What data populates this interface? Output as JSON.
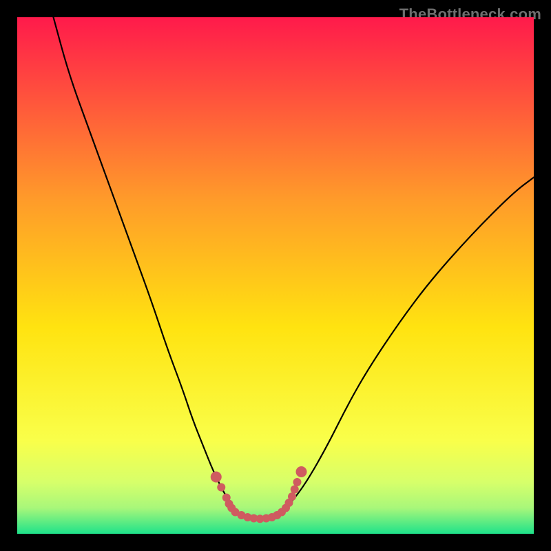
{
  "watermark": "TheBottleneck.com",
  "colors": {
    "background": "#000000",
    "gradient_top": "#ff1a4b",
    "gradient_mid_upper": "#ff9a2a",
    "gradient_mid": "#ffe310",
    "gradient_lower1": "#f9ff4a",
    "gradient_lower2": "#d7ff6a",
    "gradient_lower3": "#a8f77a",
    "gradient_bottom": "#1ee28a",
    "curve": "#000000",
    "marker_fill": "#cf5b60",
    "marker_stroke": "#cf5b60"
  },
  "chart_data": {
    "type": "line",
    "title": "",
    "xlabel": "",
    "ylabel": "",
    "xlim": [
      0,
      100
    ],
    "ylim": [
      0,
      100
    ],
    "series": [
      {
        "name": "bottleneck-curve",
        "x": [
          7,
          10,
          14,
          18,
          22,
          26,
          29,
          32,
          34,
          36,
          38,
          40,
          41.5,
          43,
          45,
          47,
          49,
          51,
          53,
          56,
          60,
          64,
          68,
          74,
          80,
          88,
          96,
          100
        ],
        "y": [
          100,
          89,
          78,
          67,
          56,
          45,
          36,
          28,
          22,
          17,
          12,
          8,
          5.5,
          4,
          3,
          2.8,
          3,
          4,
          6,
          10,
          17,
          25,
          32,
          41,
          49,
          58,
          66,
          69
        ]
      }
    ],
    "markers": {
      "name": "highlight-dots",
      "x": [
        38.5,
        39.5,
        40.5,
        41,
        41.5,
        42.2,
        43.4,
        44.6,
        45.8,
        47,
        48.2,
        49.3,
        50.3,
        51.2,
        52,
        52.6,
        53.2,
        53.7,
        54.2,
        55
      ],
      "y": [
        11,
        9,
        7,
        5.8,
        5,
        4.2,
        3.6,
        3.2,
        3,
        2.9,
        3,
        3.2,
        3.6,
        4.2,
        5,
        6,
        7.2,
        8.6,
        10,
        12
      ]
    }
  }
}
